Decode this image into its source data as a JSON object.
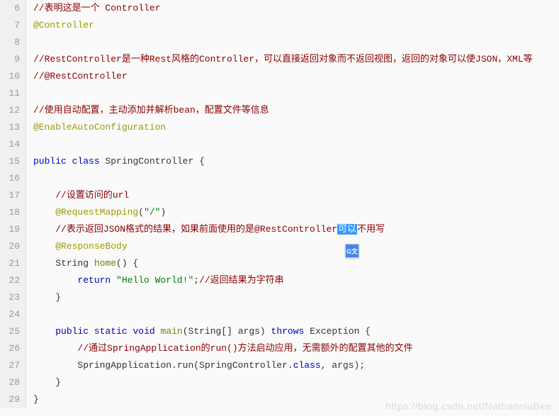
{
  "watermark": "https://blog.csdn.net/NathanniuBee",
  "translate_badge": "G文",
  "lines": [
    {
      "num": 6,
      "indent": 0,
      "tokens": [
        {
          "t": "//表明这是一个 Controller",
          "c": "cm"
        }
      ]
    },
    {
      "num": 7,
      "indent": 0,
      "tokens": [
        {
          "t": "@Controller",
          "c": "an"
        }
      ]
    },
    {
      "num": 8,
      "indent": 0,
      "tokens": []
    },
    {
      "num": 9,
      "indent": 0,
      "tokens": [
        {
          "t": "//RestController是一种Rest风格的Controller，可以直接返回对象而不返回视图，返回的对象可以使JSON，XML等",
          "c": "cm"
        }
      ]
    },
    {
      "num": 10,
      "indent": 0,
      "tokens": [
        {
          "t": "//@RestController",
          "c": "cm"
        }
      ]
    },
    {
      "num": 11,
      "indent": 0,
      "tokens": []
    },
    {
      "num": 12,
      "indent": 0,
      "tokens": [
        {
          "t": "//使用自动配置，主动添加并解析bean，配置文件等信息",
          "c": "cm"
        }
      ]
    },
    {
      "num": 13,
      "indent": 0,
      "tokens": [
        {
          "t": "@EnableAutoConfiguration",
          "c": "an"
        }
      ]
    },
    {
      "num": 14,
      "indent": 0,
      "tokens": []
    },
    {
      "num": 15,
      "indent": 0,
      "tokens": [
        {
          "t": "public",
          "c": "kw"
        },
        {
          "t": " ",
          "c": "txt"
        },
        {
          "t": "class",
          "c": "kw"
        },
        {
          "t": " SpringController {",
          "c": "txt"
        }
      ]
    },
    {
      "num": 16,
      "indent": 0,
      "tokens": []
    },
    {
      "num": 17,
      "indent": 1,
      "tokens": [
        {
          "t": "//设置访问的url",
          "c": "cm"
        }
      ]
    },
    {
      "num": 18,
      "indent": 1,
      "tokens": [
        {
          "t": "@RequestMapping",
          "c": "an"
        },
        {
          "t": "(",
          "c": "txt"
        },
        {
          "t": "\"/\"",
          "c": "str"
        },
        {
          "t": ")",
          "c": "txt"
        }
      ]
    },
    {
      "num": 19,
      "indent": 1,
      "tokens": [
        {
          "t": "//表示返回JSON格式的结果，如果前面使用的是@RestController",
          "c": "cm"
        },
        {
          "t": "可以",
          "c": "sel"
        },
        {
          "t": "不用写",
          "c": "cm"
        }
      ]
    },
    {
      "num": 20,
      "indent": 1,
      "tokens": [
        {
          "t": "@ResponseBody",
          "c": "an"
        }
      ]
    },
    {
      "num": 21,
      "indent": 1,
      "tokens": [
        {
          "t": "String ",
          "c": "txt"
        },
        {
          "t": "home",
          "c": "fn"
        },
        {
          "t": "() {",
          "c": "txt"
        }
      ]
    },
    {
      "num": 22,
      "indent": 2,
      "tokens": [
        {
          "t": "return",
          "c": "kw"
        },
        {
          "t": " ",
          "c": "txt"
        },
        {
          "t": "\"Hello World!\"",
          "c": "str"
        },
        {
          "t": ";",
          "c": "txt"
        },
        {
          "t": "//返回结果为字符串",
          "c": "cm"
        }
      ]
    },
    {
      "num": 23,
      "indent": 1,
      "tokens": [
        {
          "t": "}",
          "c": "txt"
        }
      ]
    },
    {
      "num": 24,
      "indent": 0,
      "tokens": []
    },
    {
      "num": 25,
      "indent": 1,
      "tokens": [
        {
          "t": "public",
          "c": "kw"
        },
        {
          "t": " ",
          "c": "txt"
        },
        {
          "t": "static",
          "c": "kw"
        },
        {
          "t": " ",
          "c": "txt"
        },
        {
          "t": "void",
          "c": "kw"
        },
        {
          "t": " ",
          "c": "txt"
        },
        {
          "t": "main",
          "c": "fn"
        },
        {
          "t": "(String[] args) ",
          "c": "txt"
        },
        {
          "t": "throws",
          "c": "kw"
        },
        {
          "t": " Exception {",
          "c": "txt"
        }
      ]
    },
    {
      "num": 26,
      "indent": 2,
      "tokens": [
        {
          "t": "//通过SpringApplication的run()方法启动应用，无需额外的配置其他的文件",
          "c": "cm"
        }
      ]
    },
    {
      "num": 27,
      "indent": 2,
      "tokens": [
        {
          "t": "SpringApplication.run(SpringController.",
          "c": "txt"
        },
        {
          "t": "class",
          "c": "kw"
        },
        {
          "t": ", args);",
          "c": "txt"
        }
      ]
    },
    {
      "num": 28,
      "indent": 1,
      "tokens": [
        {
          "t": "}",
          "c": "txt"
        }
      ]
    },
    {
      "num": 29,
      "indent": 0,
      "tokens": [
        {
          "t": "}",
          "c": "txt"
        }
      ]
    }
  ]
}
